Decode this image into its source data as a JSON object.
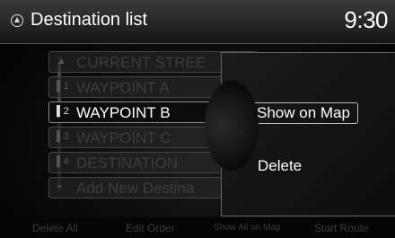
{
  "header": {
    "title": "Destination list",
    "clock": "9:30"
  },
  "list": [
    {
      "icon": "▲",
      "label": "CURRENT STREE"
    },
    {
      "icon": "▌1",
      "label": "WAYPOINT A"
    },
    {
      "icon": "▌2",
      "label": "WAYPOINT B"
    },
    {
      "icon": "▌3",
      "label": "WAYPOINT C"
    },
    {
      "icon": "▌4",
      "label": "DESTINATION"
    },
    {
      "icon": "+",
      "label": "Add New Destina"
    }
  ],
  "popup": {
    "show_on_map": "Show on Map",
    "delete": "Delete"
  },
  "bottom": {
    "delete_all": "Delete All",
    "edit_order": "Edit Order",
    "show_all": "Show All on Map",
    "start_route": "Start Route"
  }
}
